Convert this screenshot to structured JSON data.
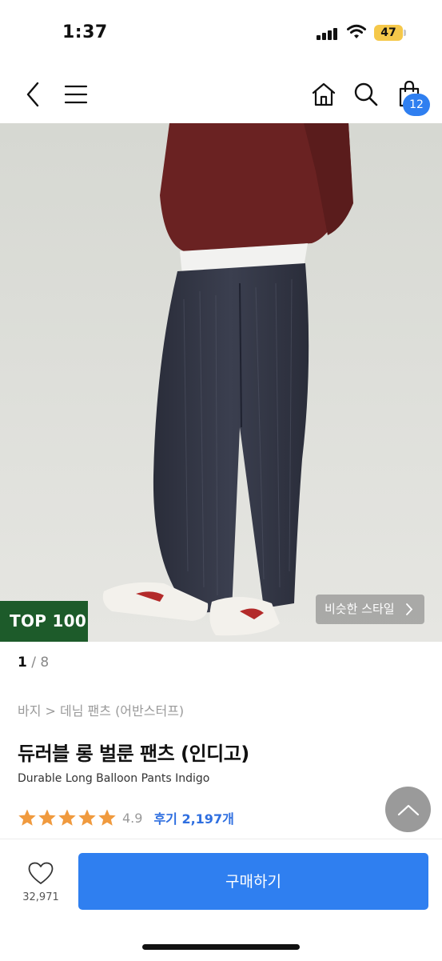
{
  "status_bar": {
    "time": "1:37",
    "battery": "47"
  },
  "nav": {
    "back_icon": "chevron-left-icon",
    "menu_icon": "hamburger-icon",
    "home_icon": "home-icon",
    "search_icon": "search-icon",
    "cart_icon": "shopping-bag-icon",
    "cart_count": "12"
  },
  "hero": {
    "badge": "TOP 100",
    "similar_style": "비슷한 스타일",
    "pager_current": "1",
    "pager_total": "/ 8"
  },
  "product": {
    "breadcrumb": "바지 > 데님 팬츠 (어반스터프)",
    "title": "듀러블 롱 벌룬 팬츠 (인디고)",
    "subtitle": "Durable Long Balloon Pants Indigo",
    "rating": "4.9",
    "stars": 5,
    "reviews": "후기 2,197개"
  },
  "bottom": {
    "like_count": "32,971",
    "buy_label": "구매하기"
  },
  "colors": {
    "accent": "#2f7ff0",
    "badge_green": "#1d5b2a",
    "star": "#f09a3e"
  }
}
